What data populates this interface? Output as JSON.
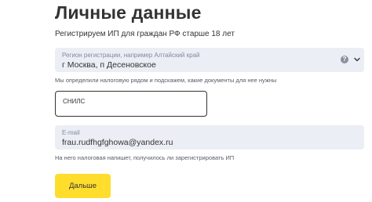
{
  "page": {
    "title": "Личные данные",
    "subtitle": "Регистрируем ИП для граждан РФ старше 18 лет"
  },
  "region": {
    "label": "Регион регистрации, например Алтайский край",
    "value": "г Москва, п Десеновское",
    "help_icon": "question-circle-icon",
    "chevron_icon": "chevron-down-icon",
    "hint": "Мы определили налоговую рядом и подскажем, какие документы для нее нужны"
  },
  "snils": {
    "placeholder": "СНИЛС"
  },
  "email": {
    "label": "E-mail",
    "value": "frau.rudfhgfghowa@yandex.ru",
    "hint": "На него налоговая напишет, получилось ли зарегистрировать ИП"
  },
  "actions": {
    "next_label": "Дальше"
  },
  "colors": {
    "accent": "#ffdd2d",
    "field_bg": "#eceef5",
    "text": "#333333"
  }
}
